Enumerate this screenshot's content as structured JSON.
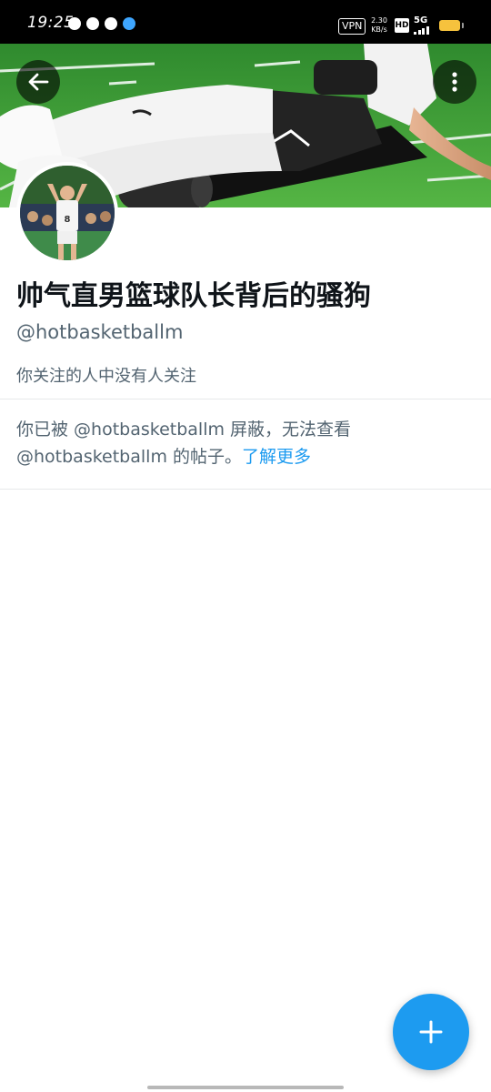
{
  "status_bar": {
    "time": "19:25",
    "vpn": "VPN",
    "speed_value": "2.30",
    "speed_unit": "KB/s",
    "hd": "HD",
    "network": "5G",
    "icons": [
      "location-icon",
      "wechat-icon",
      "telegram-icon",
      "shield-app-icon",
      "signal-icon",
      "battery-icon"
    ]
  },
  "header": {
    "back_icon": "arrow-left-icon",
    "more_icon": "more-vertical-icon"
  },
  "profile": {
    "display_name": "帅气直男篮球队长背后的骚狗",
    "handle": "@hotbasketballm",
    "followers_note": "你关注的人中没有人关注"
  },
  "blocked": {
    "line1": "你已被 @hotbasketballm 屏蔽，无法查看",
    "line2": "@hotbasketballm 的帖子。",
    "link": "了解更多"
  },
  "fab": {
    "icon": "plus-icon"
  },
  "colors": {
    "accent": "#1d9bf0",
    "text_primary": "#0f1419",
    "text_secondary": "#536471",
    "divider": "#e7e9ea",
    "status_bar_bg": "#000000",
    "battery": "#f6c23d"
  }
}
